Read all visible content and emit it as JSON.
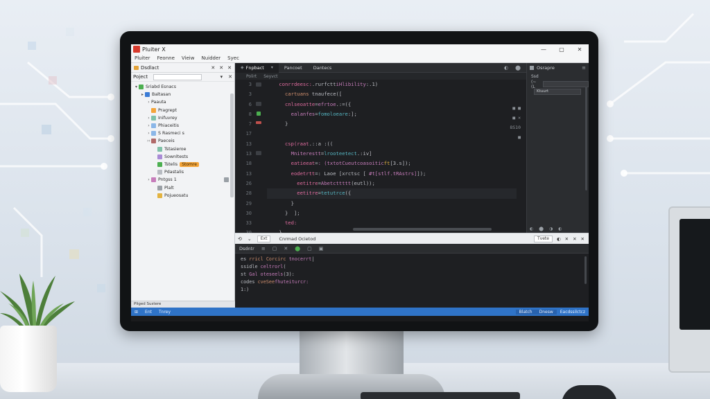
{
  "window": {
    "title": "Pluiter X",
    "controls": [
      "—",
      "▢",
      "✕"
    ]
  },
  "menu": [
    "Pluiter",
    "Feonne",
    "Vieiw",
    "Nuidder",
    "Syec"
  ],
  "project_panel": {
    "header_label": "Dsdlact",
    "tools": [
      "✕",
      "✕",
      "✕"
    ],
    "project_label": "Poject",
    "project_tools": [
      "▾",
      "✕"
    ],
    "tree": [
      {
        "label": "Sriabd Esnacs",
        "icon_color": "#4caf50",
        "arrow": "▾",
        "indent": 0
      },
      {
        "label": "Baltasan",
        "icon_color": "#3a7bd5",
        "arrow": "▸",
        "indent": 1
      },
      {
        "label": "Paauta",
        "icon_color": "",
        "arrow": "›",
        "indent": 2
      },
      {
        "label": "Pragrept",
        "icon_color": "#f4a53a",
        "arrow": "",
        "indent": 2
      },
      {
        "label": "Inifuvrey",
        "icon_color": "#7fc1a8",
        "arrow": "›",
        "indent": 2
      },
      {
        "label": "Phiaceitis",
        "icon_color": "#8bb7e8",
        "arrow": "›",
        "indent": 2
      },
      {
        "label": "S Rasmeci s",
        "icon_color": "#8bb7e8",
        "arrow": "›",
        "indent": 2
      },
      {
        "label": "Paeceis",
        "icon_color": "#b06a6a",
        "arrow": "››",
        "indent": 2
      },
      {
        "label": "Tstasieroe",
        "icon_color": "#7fc1a8",
        "arrow": "",
        "indent": 3
      },
      {
        "label": "Sownltests",
        "icon_color": "#a98bd6",
        "arrow": "",
        "indent": 3
      },
      {
        "label": "Tstelis",
        "icon_color": "#4caf50",
        "arrow": "",
        "indent": 3,
        "badge": "Stomre"
      },
      {
        "label": "Pdastalis",
        "icon_color": "#b8bcc2",
        "arrow": "",
        "indent": 3
      },
      {
        "label": "Pntgss 1",
        "icon_color": "#c77dbb",
        "arrow": "›",
        "indent": 2
      },
      {
        "label": "Plalt",
        "icon_color": "#9aa0a6",
        "arrow": "",
        "indent": 3
      },
      {
        "label": "Pojueosatu",
        "icon_color": "#e3b341",
        "arrow": "",
        "indent": 3
      }
    ],
    "footer": "Pliged Sustere"
  },
  "editor": {
    "tabs": [
      "Fnpbact",
      "Pancoet",
      "Dantecs"
    ],
    "tab_tools": [
      "◐",
      "⬤"
    ],
    "breadcrumbs": [
      "Polirt",
      "Seyvct"
    ],
    "line_numbers": [
      "3",
      "3",
      "6",
      "8",
      "7",
      "17",
      "13",
      "13",
      "18",
      "13",
      "26",
      "28",
      "29",
      "30",
      "33",
      "30"
    ],
    "code_lines": [
      [
        {
          "t": "    ",
          "c": "c-plain"
        },
        {
          "t": "conrrdeesc:",
          "c": "c-pink"
        },
        {
          "t": ".rurfctt",
          "c": "c-plain"
        },
        {
          "t": "iHlibility",
          "c": "c-fn"
        },
        {
          "t": ":.1)",
          "c": "c-plain"
        }
      ],
      [
        {
          "t": "      ",
          "c": "c-plain"
        },
        {
          "t": "cartuans",
          "c": "c-key"
        },
        {
          "t": " tnaufece([",
          "c": "c-plain"
        }
      ],
      [
        {
          "t": "      ",
          "c": "c-plain"
        },
        {
          "t": "cnlseoatte",
          "c": "c-pink"
        },
        {
          "t": "=",
          "c": "c-plain"
        },
        {
          "t": "efrtoe",
          "c": "c-fn"
        },
        {
          "t": ".:=({",
          "c": "c-plain"
        }
      ],
      [
        {
          "t": "        ",
          "c": "c-plain"
        },
        {
          "t": "ealanfes",
          "c": "c-fn"
        },
        {
          "t": "=",
          "c": "c-plain"
        },
        {
          "t": "fomoloeare",
          "c": "c-cyan"
        },
        {
          "t": ":];",
          "c": "c-plain"
        }
      ],
      [
        {
          "t": "      }",
          "c": "c-plain"
        }
      ],
      [
        {
          "t": "",
          "c": "c-plain"
        }
      ],
      [
        {
          "t": "      ",
          "c": "c-plain"
        },
        {
          "t": "csp(raat",
          "c": "c-pink"
        },
        {
          "t": ".::a :((",
          "c": "c-plain"
        }
      ],
      [
        {
          "t": "        ",
          "c": "c-plain"
        },
        {
          "t": "Mniterestt",
          "c": "c-fn"
        },
        {
          "t": "=",
          "c": "c-plain"
        },
        {
          "t": "lrooteetect",
          "c": "c-cyan"
        },
        {
          "t": ".:iv]",
          "c": "c-plain"
        }
      ],
      [
        {
          "t": "        ",
          "c": "c-plain"
        },
        {
          "t": "eatieeat",
          "c": "c-pink"
        },
        {
          "t": "=",
          "c": "c-plain"
        },
        {
          "t": ": (txtotCueutcoasoitic",
          "c": "c-fn"
        },
        {
          "t": "ft",
          "c": "c-num"
        },
        {
          "t": "[3.s]);",
          "c": "c-plain"
        }
      ],
      [
        {
          "t": "        ",
          "c": "c-plain"
        },
        {
          "t": "eodetrtt",
          "c": "c-pink"
        },
        {
          "t": "=",
          "c": "c-plain"
        },
        {
          "t": ": Laoe [xrctsc [ ",
          "c": "c-plain"
        },
        {
          "t": "#t[stlf.tRAstrs]",
          "c": "c-fn"
        },
        {
          "t": "]);",
          "c": "c-plain"
        }
      ],
      [
        {
          "t": "          ",
          "c": "c-plain"
        },
        {
          "t": "eetitre",
          "c": "c-pink"
        },
        {
          "t": "=",
          "c": "c-plain"
        },
        {
          "t": "Abetcttttt",
          "c": "c-fn"
        },
        {
          "t": "(eutl));",
          "c": "c-plain"
        }
      ],
      [
        {
          "t": "          ",
          "c": "c-plain"
        },
        {
          "t": "eetitre",
          "c": "c-pink"
        },
        {
          "t": "=",
          "c": "c-plain"
        },
        {
          "t": "tetutrce",
          "c": "c-cyan"
        },
        {
          "t": "({",
          "c": "c-plain"
        }
      ],
      [
        {
          "t": "        }",
          "c": "c-plain"
        }
      ],
      [
        {
          "t": "      }  ];",
          "c": "c-plain"
        }
      ],
      [
        {
          "t": "      ",
          "c": "c-plain"
        },
        {
          "t": "ted:",
          "c": "c-pink"
        }
      ],
      [
        {
          "t": "    }",
          "c": "c-plain"
        }
      ]
    ],
    "right_gutter": [
      "■ ■",
      "■ ✕",
      "8S10",
      "■"
    ],
    "status_tools": [
      "✕",
      "✕",
      "✕",
      "✕",
      "✕"
    ]
  },
  "right_panel": {
    "title": "Osrapre",
    "tools": "≡",
    "rows": [
      {
        "label": "Ssd",
        "field": ""
      },
      {
        "label": "(~(L",
        "field": ""
      },
      {
        "label": "",
        "field": "Ktuurt"
      }
    ],
    "footer_tools": [
      "◐",
      "⬤",
      "◑",
      "◐"
    ]
  },
  "find_bar": {
    "buttons": [
      "⟲",
      "⌄"
    ],
    "field_value": "Ext",
    "label": "Cnrmad Ocietod",
    "tools": [
      "Tvete",
      "◐",
      "✕",
      "✕",
      "✕"
    ]
  },
  "console": {
    "title": "Dsdntr",
    "tools": [
      "≡",
      "▢",
      "✕",
      "⬤",
      "▢",
      "▣"
    ],
    "lines": [
      [
        {
          "t": "es ",
          "c": "c-plain"
        },
        {
          "t": "rricl Corcirc",
          "c": "c-key"
        },
        {
          "t": " tnocerrt",
          "c": "c-fn"
        },
        {
          "t": "|",
          "c": "c-plain"
        }
      ],
      [
        {
          "t": "ssidle ",
          "c": "c-plain"
        },
        {
          "t": "celtrorl",
          "c": "c-fn"
        },
        {
          "t": "(",
          "c": "c-plain"
        }
      ],
      [
        {
          "t": "st ",
          "c": "c-plain"
        },
        {
          "t": "Gal oteseels",
          "c": "c-fn"
        },
        {
          "t": "(3):",
          "c": "c-plain"
        }
      ],
      [
        {
          "t": "codes ",
          "c": "c-plain"
        },
        {
          "t": "cveSee",
          "c": "c-key"
        },
        {
          "t": "fhuteiturcr:",
          "c": "c-fn"
        }
      ],
      [
        {
          "t": "1:)",
          "c": "c-plain"
        }
      ]
    ]
  },
  "status_bar": {
    "left": [
      "⊞",
      "Ent",
      "Tnrey"
    ],
    "right": [
      "Blatch",
      "Dnesw",
      "Eacdssilctcz"
    ]
  }
}
